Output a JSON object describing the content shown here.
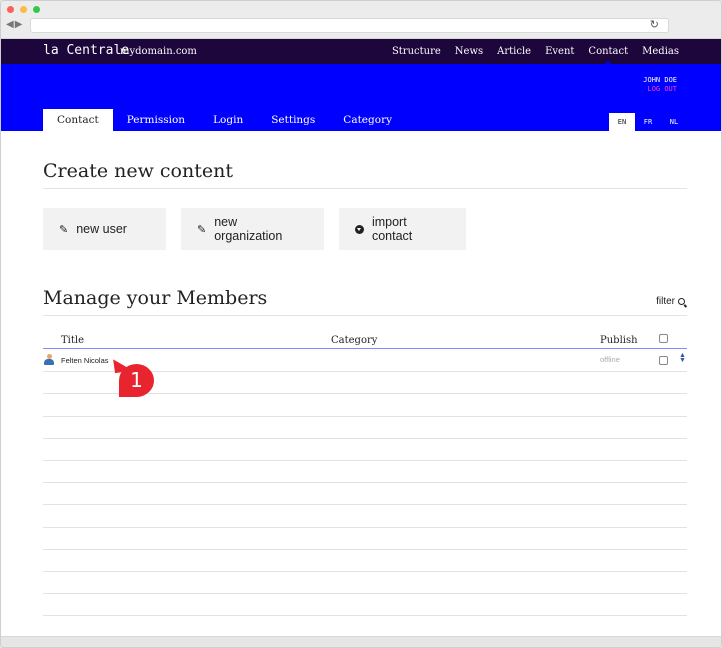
{
  "site": {
    "brand": "la Centrale",
    "domain": "mydomain.com"
  },
  "topnav": [
    {
      "label": "Structure",
      "active": false
    },
    {
      "label": "News",
      "active": false
    },
    {
      "label": "Article",
      "active": false
    },
    {
      "label": "Event",
      "active": false
    },
    {
      "label": "Contact",
      "active": true
    },
    {
      "label": "Medias",
      "active": false
    }
  ],
  "user": {
    "name": "JOHN DOE",
    "logout": "LOG OUT"
  },
  "tabs": [
    {
      "label": "Contact",
      "active": true
    },
    {
      "label": "Permission",
      "active": false
    },
    {
      "label": "Login",
      "active": false
    },
    {
      "label": "Settings",
      "active": false
    },
    {
      "label": "Category",
      "active": false
    }
  ],
  "languages": [
    {
      "label": "EN",
      "active": true
    },
    {
      "label": "FR",
      "active": false
    },
    {
      "label": "NL",
      "active": false
    }
  ],
  "create": {
    "title": "Create new content",
    "actions": [
      {
        "label": "new user",
        "icon": "pencil-icon"
      },
      {
        "label": "new organization",
        "icon": "pencil-icon"
      },
      {
        "label": "import contact",
        "icon": "download-circle-icon"
      }
    ]
  },
  "manage": {
    "title": "Manage your Members",
    "filter_label": "filter",
    "columns": {
      "title": "Title",
      "category": "Category",
      "publish": "Publish"
    },
    "rows": [
      {
        "title": "Felten Nicolas",
        "category": "",
        "status": "offline"
      }
    ],
    "empty_rows": 12
  },
  "callout": {
    "number": "1",
    "color": "#e8242e"
  },
  "colors": {
    "topbar": "#1c063b",
    "accent": "#0000ff",
    "logout": "#ff3ccf"
  }
}
